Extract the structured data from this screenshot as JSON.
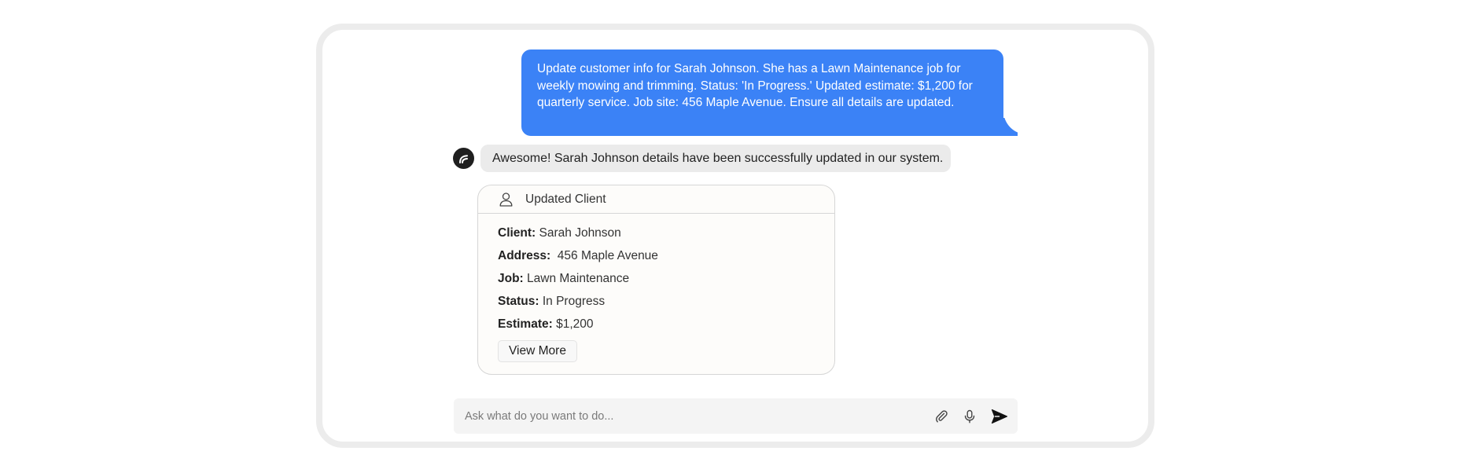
{
  "chat": {
    "user_message": "Update customer info for Sarah Johnson. She has a Lawn Maintenance job for weekly mowing and trimming. Status: 'In Progress.' Updated estimate: $1,200 for quarterly service. Job site: 456 Maple Avenue. Ensure all details are updated.",
    "bot_message": "Awesome! Sarah Johnson details have been successfully updated in our system."
  },
  "card": {
    "header_icon": "person-icon",
    "title": "Updated Client",
    "fields": [
      {
        "label": "Client:",
        "value": " Sarah Johnson"
      },
      {
        "label": "Address:",
        "value": "  456 Maple Avenue"
      },
      {
        "label": "Job:",
        "value": " Lawn Maintenance"
      },
      {
        "label": "Status:",
        "value": " In Progress"
      },
      {
        "label": "Estimate:",
        "value": " $1,200"
      }
    ],
    "view_more_label": "View More"
  },
  "composer": {
    "placeholder": "Ask what do you want to do...",
    "icons": [
      "paperclip-icon",
      "microphone-icon",
      "send-icon"
    ]
  },
  "colors": {
    "user_bubble": "#3b82f6",
    "bot_bubble": "#ebebeb",
    "avatar": "#1f1f1f",
    "frame_border": "#ececec"
  }
}
